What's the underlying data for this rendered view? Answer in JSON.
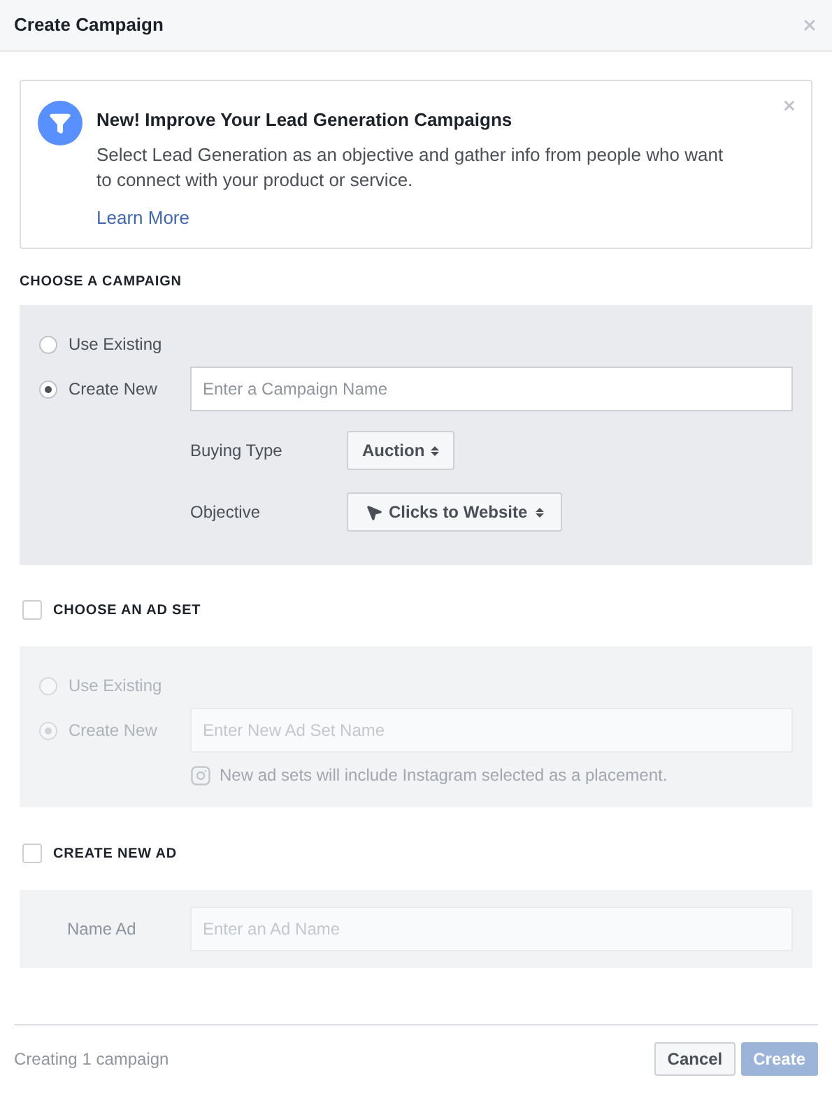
{
  "window": {
    "title": "Create Campaign"
  },
  "notice": {
    "title": "New! Improve Your Lead Generation Campaigns",
    "body": "Select Lead Generation as an objective and gather info from people who want to connect with your product or service.",
    "link": "Learn More"
  },
  "campaign": {
    "heading": "CHOOSE A CAMPAIGN",
    "options": [
      {
        "label": "Use Existing",
        "selected": false
      },
      {
        "label": "Create New",
        "selected": true
      }
    ],
    "name_field": {
      "placeholder": "Enter a Campaign Name"
    },
    "buying_type": {
      "label": "Buying Type",
      "value": "Auction"
    },
    "objective": {
      "label": "Objective",
      "value": "Clicks to Website"
    }
  },
  "ad_set": {
    "heading": "CHOOSE AN AD SET",
    "checked": false,
    "disabled": true,
    "options": [
      {
        "label": "Use Existing",
        "selected": false
      },
      {
        "label": "Create New",
        "selected": true
      }
    ],
    "name_field": {
      "placeholder": "Enter New Ad Set Name"
    },
    "note": "New ad sets will include Instagram selected as a placement."
  },
  "ad": {
    "heading": "CREATE NEW AD",
    "checked": false,
    "disabled": true,
    "label": "Name Ad",
    "name_field": {
      "placeholder": "Enter an Ad Name"
    }
  },
  "footer": {
    "status": "Creating 1 campaign",
    "buttons": [
      {
        "label": "Cancel",
        "kind": "secondary",
        "disabled": false
      },
      {
        "label": "Create",
        "kind": "primary",
        "disabled": true
      }
    ]
  }
}
